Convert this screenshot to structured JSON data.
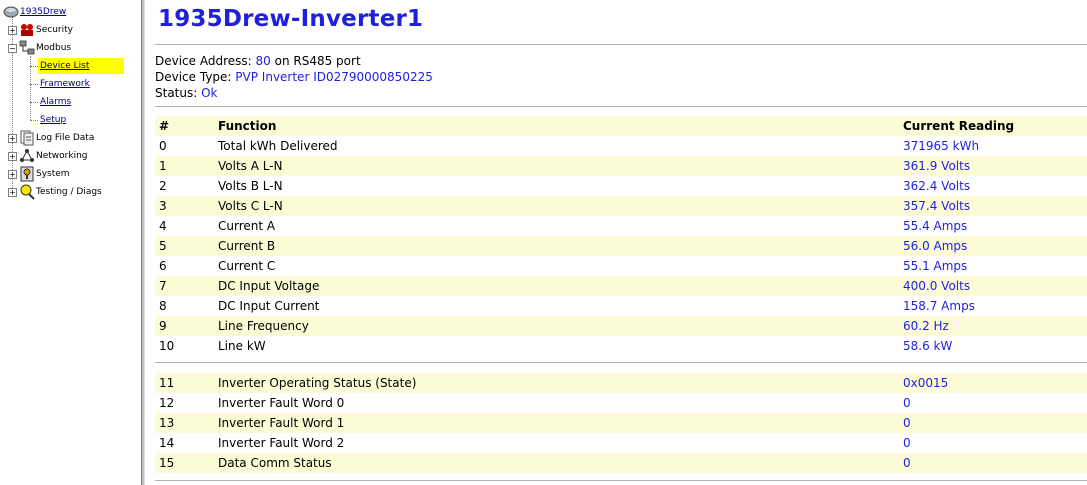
{
  "sidebar": {
    "root_label": "1935Drew",
    "items": [
      {
        "label": "Security",
        "icon": "users-key-icon"
      },
      {
        "label": "Modbus",
        "icon": "network-devices-icon"
      },
      {
        "label": "Log File Data",
        "icon": "log-file-icon"
      },
      {
        "label": "Networking",
        "icon": "network-icon"
      },
      {
        "label": "System",
        "icon": "system-icon"
      },
      {
        "label": "Testing / Diags",
        "icon": "magnifier-icon"
      }
    ],
    "modbus_children": [
      "Device List",
      "Framework",
      "Alarms",
      "Setup"
    ],
    "selected": "Device List"
  },
  "page": {
    "title": "1935Drew-Inverter1",
    "device_address_label": "Device Address:",
    "device_address_value": "80",
    "device_address_suffix": "on RS485 port",
    "device_type_label": "Device Type:",
    "device_type_value": "PVP Inverter ID02790000850225",
    "status_label": "Status:",
    "status_value": "Ok"
  },
  "table": {
    "headers": [
      "#",
      "Function",
      "Current Reading"
    ],
    "group1": [
      [
        "0",
        "Total kWh Delivered",
        "371965 kWh"
      ],
      [
        "1",
        "Volts A L-N",
        "361.9 Volts"
      ],
      [
        "2",
        "Volts B L-N",
        "362.4 Volts"
      ],
      [
        "3",
        "Volts C L-N",
        "357.4 Volts"
      ],
      [
        "4",
        "Current A",
        "55.4 Amps"
      ],
      [
        "5",
        "Current B",
        "56.0 Amps"
      ],
      [
        "6",
        "Current C",
        "55.1 Amps"
      ],
      [
        "7",
        "DC Input Voltage",
        "400.0 Volts"
      ],
      [
        "8",
        "DC Input Current",
        "158.7 Amps"
      ],
      [
        "9",
        "Line Frequency",
        "60.2 Hz"
      ],
      [
        "10",
        "Line kW",
        "58.6 kW"
      ]
    ],
    "group2": [
      [
        "11",
        "Inverter Operating Status (State)",
        "0x0015"
      ],
      [
        "12",
        "Inverter Fault Word 0",
        "0"
      ],
      [
        "13",
        "Inverter Fault Word 1",
        "0"
      ],
      [
        "14",
        "Inverter Fault Word 2",
        "0"
      ],
      [
        "15",
        "Data Comm Status",
        "0"
      ]
    ]
  },
  "colors": {
    "accent": "#1f1fe0",
    "row_shade": "#fbfbd6",
    "selected": "#ffff00"
  }
}
